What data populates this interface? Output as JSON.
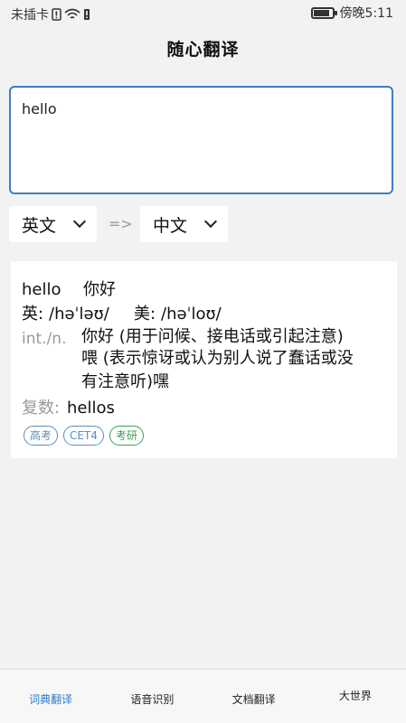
{
  "status": {
    "carrier": "未插卡",
    "time": "傍晚5:11"
  },
  "header": {
    "title": "随心翻译"
  },
  "input": {
    "value": "hello"
  },
  "lang": {
    "source": "英文",
    "arrow": "=>",
    "target": "中文"
  },
  "result": {
    "word": "hello",
    "brief": "你好",
    "uk_label": "英:",
    "uk_phonetic": "/həˈləʊ/",
    "us_label": "美:",
    "us_phonetic": "/həˈloʊ/",
    "pos": "int./n.",
    "meaning_line1": "你好 (用于问候、接电话或引起注意)",
    "meaning_line2": "喂 (表示惊讶或认为别人说了蠢话或没",
    "meaning_line3": "有注意听)嘿",
    "plural_label": "复数:",
    "plural_value": "hellos",
    "tags": [
      "高考",
      "CET4",
      "考研"
    ]
  },
  "nav": {
    "items": [
      "词典翻译",
      "语音识别",
      "文档翻译",
      "大世界"
    ],
    "active_color": "#2f7bd0"
  },
  "colors": {
    "accent": "#3f7fbf",
    "tag_blue": "#5a8fbf",
    "tag_green": "#3aa05a"
  }
}
